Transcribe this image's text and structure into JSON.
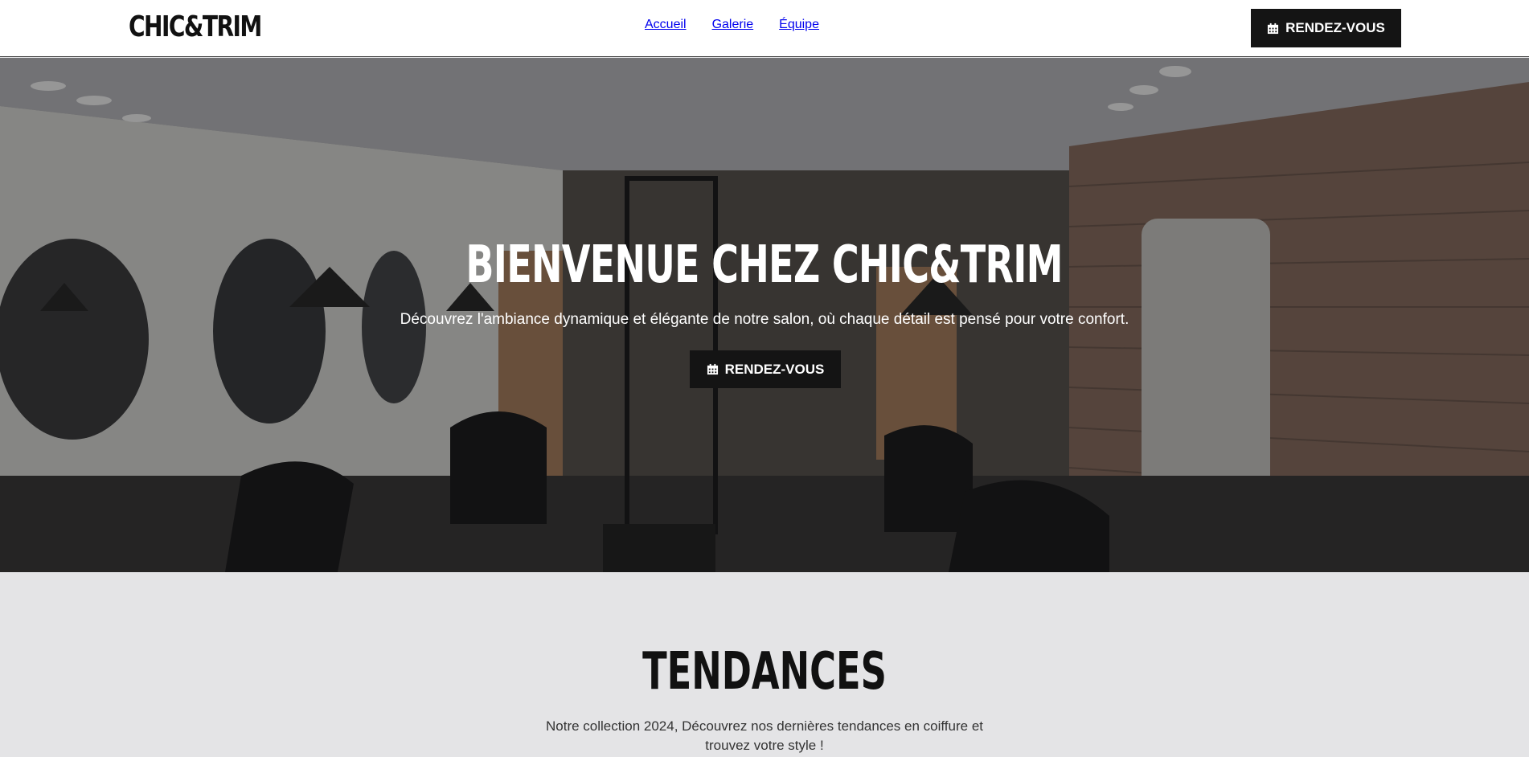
{
  "header": {
    "logo": "CHIC&TRIM",
    "nav": [
      "Accueil",
      "Galerie",
      "Équipe"
    ],
    "cta_label": "RENDEZ-VOUS",
    "cta_icon": "calendar-icon"
  },
  "hero": {
    "title": "BIENVENUE CHEZ CHIC&TRIM",
    "subtitle": "Découvrez l'ambiance dynamique et élégante de notre salon, où chaque détail est pensé pour votre confort.",
    "cta_label": "RENDEZ-VOUS",
    "cta_icon": "calendar-icon"
  },
  "trends": {
    "title": "TENDANCES",
    "text": "Notre collection 2024, Découvrez nos dernières tendances en coiffure et trouvez votre style !"
  },
  "colors": {
    "button_bg": "#141414",
    "section_bg": "#e4e4e6"
  }
}
